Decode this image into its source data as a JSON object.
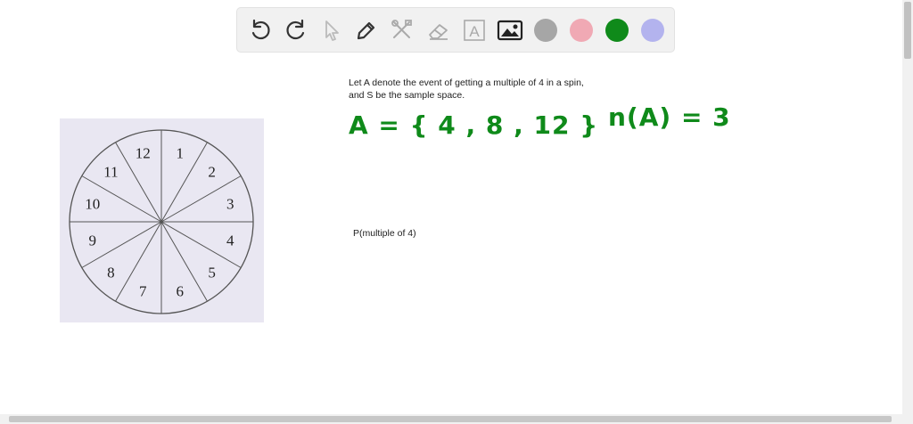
{
  "toolbar": {
    "tools": [
      {
        "name": "undo-icon"
      },
      {
        "name": "redo-icon"
      },
      {
        "name": "pointer-icon"
      },
      {
        "name": "pen-icon"
      },
      {
        "name": "tools-icon"
      },
      {
        "name": "eraser-icon"
      },
      {
        "name": "text-icon",
        "glyph": "A"
      },
      {
        "name": "image-icon"
      }
    ],
    "colors": [
      "#a6a6a6",
      "#f0a9b4",
      "#0f8a1a",
      "#b3b3ee"
    ]
  },
  "wheel": {
    "sectors": [
      "1",
      "2",
      "3",
      "4",
      "5",
      "6",
      "7",
      "8",
      "9",
      "10",
      "11",
      "12"
    ]
  },
  "problem": {
    "line1": "Let  A denote the event of getting a multiple of 4 in a spin,",
    "line2": "and S be the sample space."
  },
  "handwriting": {
    "set_a": "A = { 4 , 8 , 12 }",
    "count_a": "n(A) = 3"
  },
  "probability_label": "P(multiple of 4)"
}
